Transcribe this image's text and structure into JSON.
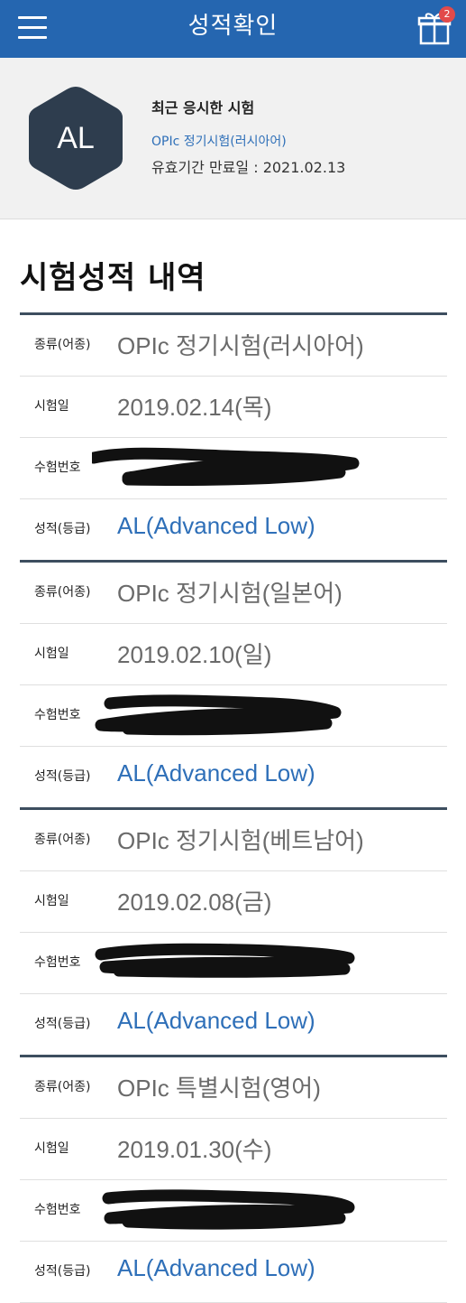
{
  "header": {
    "title": "성적확인",
    "gift_badge_count": "2"
  },
  "recent": {
    "badge": "AL",
    "title": "최근 응시한 시험",
    "exam": "OPIc 정기시험(러시아어)",
    "expiry": "유효기간 만료일 : 2021.02.13"
  },
  "section_title": "시험성적 내역",
  "labels": {
    "type": "종류(어종)",
    "date": "시험일",
    "number": "수험번호",
    "grade": "성적(등급)"
  },
  "records": [
    {
      "type": "OPIc 정기시험(러시아어)",
      "date": "2019.02.14(목)",
      "grade": "AL(Advanced Low)"
    },
    {
      "type": "OPIc 정기시험(일본어)",
      "date": "2019.02.10(일)",
      "grade": "AL(Advanced Low)"
    },
    {
      "type": "OPIc 정기시험(베트남어)",
      "date": "2019.02.08(금)",
      "grade": "AL(Advanced Low)"
    },
    {
      "type": "OPIc 특별시험(영어)",
      "date": "2019.01.30(수)",
      "grade": "AL(Advanced Low)"
    }
  ],
  "colors": {
    "header_bg": "#2566b0",
    "badge_hex": "#2e3d4e",
    "link": "#2e6fb8",
    "divider": "#3d4e5f"
  },
  "icons": {
    "menu": "hamburger-menu-icon",
    "gift": "gift-icon"
  }
}
